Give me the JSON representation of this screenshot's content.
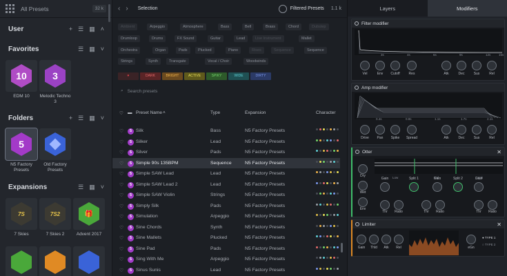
{
  "left": {
    "header": "All Presets",
    "count": "32 k",
    "user": "User",
    "favorites": "Favorites",
    "folders": "Folders",
    "expansions": "Expansions",
    "fav_tiles": [
      {
        "name": "EDM 10",
        "icon": "10"
      },
      {
        "name": "Melodic Techno 3",
        "icon": "3"
      }
    ],
    "folder_tiles": [
      {
        "name": "N5 Factory Presets",
        "icon": "5"
      },
      {
        "name": "Old Factory Presets",
        "icon": "cube"
      }
    ],
    "exp_tiles": [
      {
        "name": "7 Skies"
      },
      {
        "name": "7 Skies 2"
      },
      {
        "name": "Advent 2017"
      }
    ]
  },
  "middle": {
    "selection": "Selection",
    "filtered": "Filtered Presets",
    "filtered_count": "1.1 k",
    "tags": [
      "Ambient",
      "Arpeggio",
      "Atmosphere",
      "Bass",
      "Bell",
      "Brass",
      "Chord",
      "Dubstep",
      "Drumloop",
      "Drums",
      "FX Sound",
      "Guitar",
      "Lead",
      "Live Instrument",
      "Mallet",
      "Orchestra",
      "Organ",
      "Pads",
      "Plucked",
      "Piano",
      "Rises",
      "Sequence",
      "Sequence",
      "Strings",
      "Synth",
      "Transgate",
      "Vocal / Choir",
      "Woodwinds"
    ],
    "characters": [
      "♥",
      "DARK",
      "BRIGHT",
      "ACTIVE",
      "SPIKY",
      "WIDE",
      "DIRTY"
    ],
    "search_placeholder": "Search presets",
    "columns": {
      "name": "Preset Name",
      "type": "Type",
      "expansion": "Expansion",
      "character": "Character"
    },
    "rows": [
      {
        "name": "Silk",
        "type": "Bass",
        "exp": "N5 Factory Presets"
      },
      {
        "name": "Silker",
        "type": "Lead",
        "exp": "N5 Factory Presets"
      },
      {
        "name": "Silver",
        "type": "Pads",
        "exp": "N5 Factory Presets"
      },
      {
        "name": "Simple 90s 135BPM",
        "type": "Sequence",
        "exp": "N5 Factory Presets"
      },
      {
        "name": "Simple SAW Lead",
        "type": "Lead",
        "exp": "N5 Factory Presets"
      },
      {
        "name": "Simple SAW Lead 2",
        "type": "Lead",
        "exp": "N5 Factory Presets"
      },
      {
        "name": "Simple SAW Violin",
        "type": "Strings",
        "exp": "N5 Factory Presets"
      },
      {
        "name": "Simply Silk",
        "type": "Pads",
        "exp": "N5 Factory Presets"
      },
      {
        "name": "Simulation",
        "type": "Arpeggio",
        "exp": "N5 Factory Presets"
      },
      {
        "name": "Sine Chords",
        "type": "Synth",
        "exp": "N5 Factory Presets"
      },
      {
        "name": "Sine Mallets",
        "type": "Plucked",
        "exp": "N5 Factory Presets"
      },
      {
        "name": "Sine Pad",
        "type": "Pads",
        "exp": "N5 Factory Presets"
      },
      {
        "name": "Sing With Me",
        "type": "Arpeggio",
        "exp": "N5 Factory Presets"
      },
      {
        "name": "Sinus Sunis",
        "type": "Lead",
        "exp": "N5 Factory Presets"
      }
    ]
  },
  "right": {
    "tabs": [
      "Layers",
      "Modifiers"
    ],
    "filter": {
      "title": "Filter modifier",
      "ticks": [
        "3s",
        "4s",
        "6s",
        "9s",
        "12s",
        "15s"
      ],
      "knobs": [
        "Vel",
        "Env",
        "Cutoff",
        "Res",
        "Atk",
        "Dec",
        "Sus",
        "Rel"
      ]
    },
    "amp": {
      "title": "Amp modifier",
      "ticks": [
        "0.4s",
        "0.8s",
        "1.1s",
        "1.7s",
        "2.1s"
      ],
      "knobs": [
        "Drive",
        "Pan",
        "Spike",
        "Spread",
        "Atk",
        "Dec",
        "Sus",
        "Rel"
      ]
    },
    "otter": {
      "title": "Otter",
      "bands": [
        "Low",
        "Mid",
        "High"
      ],
      "left_knobs": [
        "Dry",
        "Wet",
        "Env"
      ],
      "knobs": [
        "Gain",
        "Split 1",
        "Gain",
        "Split 2",
        "Gain",
        "Thr",
        "Ratio",
        "Thr",
        "Ratio",
        "Thr",
        "Ratio"
      ]
    },
    "limiter": {
      "title": "Limiter",
      "knobs": [
        "Gain",
        "Thld",
        "Atk",
        "Rel"
      ],
      "ceil": "eGn",
      "types": [
        "TYPE 1",
        "TYPE 2"
      ]
    }
  }
}
